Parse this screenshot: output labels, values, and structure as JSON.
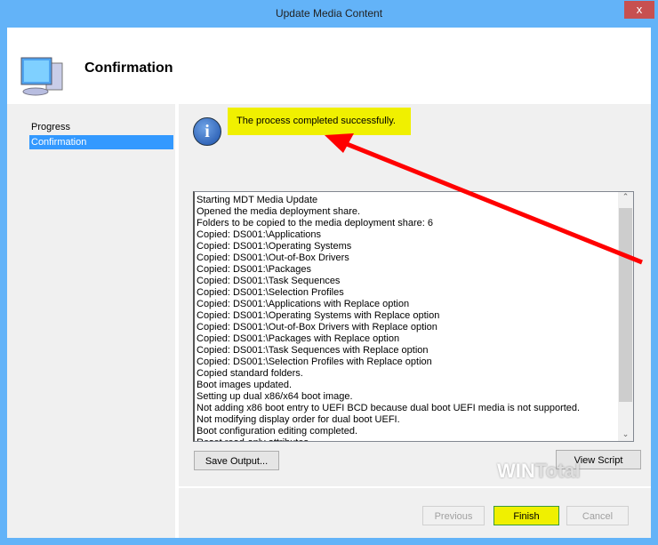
{
  "window": {
    "title": "Update Media Content",
    "close_label": "x"
  },
  "header": {
    "title": "Confirmation",
    "icon": "computer-icon"
  },
  "sidebar": {
    "items": [
      {
        "label": "Progress"
      },
      {
        "label": "Confirmation",
        "selected": true
      }
    ]
  },
  "status": {
    "icon": "info-icon",
    "message": "The process completed successfully.",
    "highlight": "#f0f000"
  },
  "log": {
    "lines": [
      "Starting MDT Media Update",
      "Opened the media deployment share.",
      "Folders to be copied to the media deployment share: 6",
      "Copied: DS001:\\Applications",
      "Copied: DS001:\\Operating Systems",
      "Copied: DS001:\\Out-of-Box Drivers",
      "Copied: DS001:\\Packages",
      "Copied: DS001:\\Task Sequences",
      "Copied: DS001:\\Selection Profiles",
      "Copied: DS001:\\Applications with Replace option",
      "Copied: DS001:\\Operating Systems with Replace option",
      "Copied: DS001:\\Out-of-Box Drivers with Replace option",
      "Copied: DS001:\\Packages with Replace option",
      "Copied: DS001:\\Task Sequences with Replace option",
      "Copied: DS001:\\Selection Profiles with Replace option",
      "Copied standard folders.",
      "Boot images updated.",
      "Setting up dual x86/x64 boot image.",
      "Not adding x86 boot entry to UEFI BCD because dual boot UEFI media is not supported.",
      "Not modifying display order for dual boot UEFI.",
      "Boot configuration editing completed.",
      "Reset read-only attributes"
    ]
  },
  "buttons": {
    "save_output": "Save Output...",
    "view_script": "View Script",
    "previous": "Previous",
    "finish": "Finish",
    "cancel": "Cancel"
  },
  "watermark": "WIN Total",
  "colors": {
    "titlebar": "#63b3f8",
    "arrow": "#ff0000",
    "selection": "#3399ff"
  }
}
